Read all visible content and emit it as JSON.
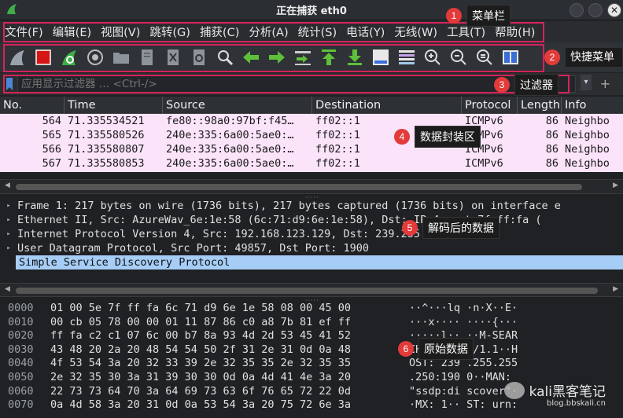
{
  "window": {
    "title": "正在捕获 eth0",
    "close_glyph": "✕"
  },
  "menu": [
    "文件(F)",
    "编辑(E)",
    "视图(V)",
    "跳转(G)",
    "捕获(C)",
    "分析(A)",
    "统计(S)",
    "电话(Y)",
    "无线(W)",
    "工具(T)",
    "帮助(H)"
  ],
  "toolbar": [
    "start-capture-icon",
    "stop-capture-icon",
    "restart-capture-icon",
    "options-gear-icon",
    "open-folder-icon",
    "save-file-icon",
    "close-file-icon",
    "reload-icon",
    "find-icon",
    "back-arrow-icon",
    "forward-arrow-icon",
    "goto-packet-icon",
    "first-packet-icon",
    "last-packet-icon",
    "autoscroll-icon",
    "colorize-icon",
    "zoom-in-icon",
    "zoom-out-icon",
    "normal-size-icon",
    "resize-columns-icon"
  ],
  "filter": {
    "placeholder": "应用显示过滤器 … <Ctrl-/>",
    "add": "+"
  },
  "columns": [
    "No.",
    "Time",
    "Source",
    "Destination",
    "Protocol",
    "Length",
    "Info"
  ],
  "packets": [
    {
      "no": "564",
      "time": "71.335534521",
      "src": "fe80::98a0:97bf:f45…",
      "dst": "ff02::1",
      "proto": "ICMPv6",
      "len": "86",
      "info": "Neighbo"
    },
    {
      "no": "565",
      "time": "71.335580526",
      "src": "240e:335:6a00:5ae0:…",
      "dst": "ff02::1",
      "proto": "ICMPv6",
      "len": "86",
      "info": "Neighbo"
    },
    {
      "no": "566",
      "time": "71.335580807",
      "src": "240e:335:6a00:5ae0:…",
      "dst": "ff02::1",
      "proto": "ICMPv6",
      "len": "86",
      "info": "Neighbo"
    },
    {
      "no": "567",
      "time": "71.335580853",
      "src": "240e:335:6a00:5ae0:…",
      "dst": "ff02::1",
      "proto": "ICMPv6",
      "len": "86",
      "info": "Neighbo"
    }
  ],
  "details": [
    {
      "text": "Frame 1: 217 bytes on wire (1736 bits), 217 bytes captured (1736 bits) on interface e",
      "expander": "▸"
    },
    {
      "text": "Ethernet II, Src: AzureWav_6e:1e:58 (6c:71:d9:6e:1e:58), Dst: IPv4mcast_7f:ff:fa (",
      "expander": "▸"
    },
    {
      "text": "Internet Protocol Version 4, Src: 192.168.123.129, Dst: 239.255.255.250",
      "expander": "▸"
    },
    {
      "text": "User Datagram Protocol, Src Port: 49857, Dst Port: 1900",
      "expander": "▸"
    },
    {
      "text": "Simple Service Discovery Protocol",
      "expander": ""
    }
  ],
  "hex": [
    {
      "off": "0000",
      "bytes": "01 00 5e 7f ff fa 6c 71  d9 6e 1e 58 08 00 45 00",
      "ascii": "··^···lq ·n·X··E·"
    },
    {
      "off": "0010",
      "bytes": "00 cb 05 78 00 00 01 11  87 86 c0 a8 7b 81 ef ff",
      "ascii": "···x···· ····{···"
    },
    {
      "off": "0020",
      "bytes": "ff fa c2 c1 07 6c 00 b7  8a 93 4d 2d 53 45 41 52",
      "ascii": "·····l·· ··M-SEAR"
    },
    {
      "off": "0030",
      "bytes": "43 48 20 2a 20 48 54 54  50 2f 31 2e 31 0d 0a 48",
      "ascii": "CH * HTT P/1.1··H"
    },
    {
      "off": "0040",
      "bytes": "4f 53 54 3a 20 32 33 39  2e 32 35 35 2e 32 35 35",
      "ascii": "OST: 239 .255.255"
    },
    {
      "off": "0050",
      "bytes": "2e 32 35 30 3a 31 39 30  30 0d 0a 4d 41 4e 3a 20",
      "ascii": ".250:190 0··MAN: "
    },
    {
      "off": "0060",
      "bytes": "22 73 73 64 70 3a 64 69  73 63 6f 76 65 72 22 0d",
      "ascii": "\"ssdp:di scover\"·"
    },
    {
      "off": "0070",
      "bytes": "0a 4d 58 3a 20 31 0d 0a  53 54 3a 20 75 72 6e 3a",
      "ascii": "·MX: 1·· ST: urn:"
    }
  ],
  "callouts": [
    {
      "num": "1",
      "text": "菜单栏"
    },
    {
      "num": "2",
      "text": "快捷菜单"
    },
    {
      "num": "3",
      "text": "过滤器"
    },
    {
      "num": "4",
      "text": "数据封装区"
    },
    {
      "num": "5",
      "text": "解码后的数据"
    },
    {
      "num": "6",
      "text": "原始数据"
    }
  ],
  "watermark": {
    "main": "kali黑客笔记",
    "sub": "blog.bbskali.cn"
  },
  "colors": {
    "annotation": "#d4245a",
    "badge": "#e33a3a",
    "packet_bg": "#fbe3fa",
    "selected": "#a6cdf5"
  }
}
